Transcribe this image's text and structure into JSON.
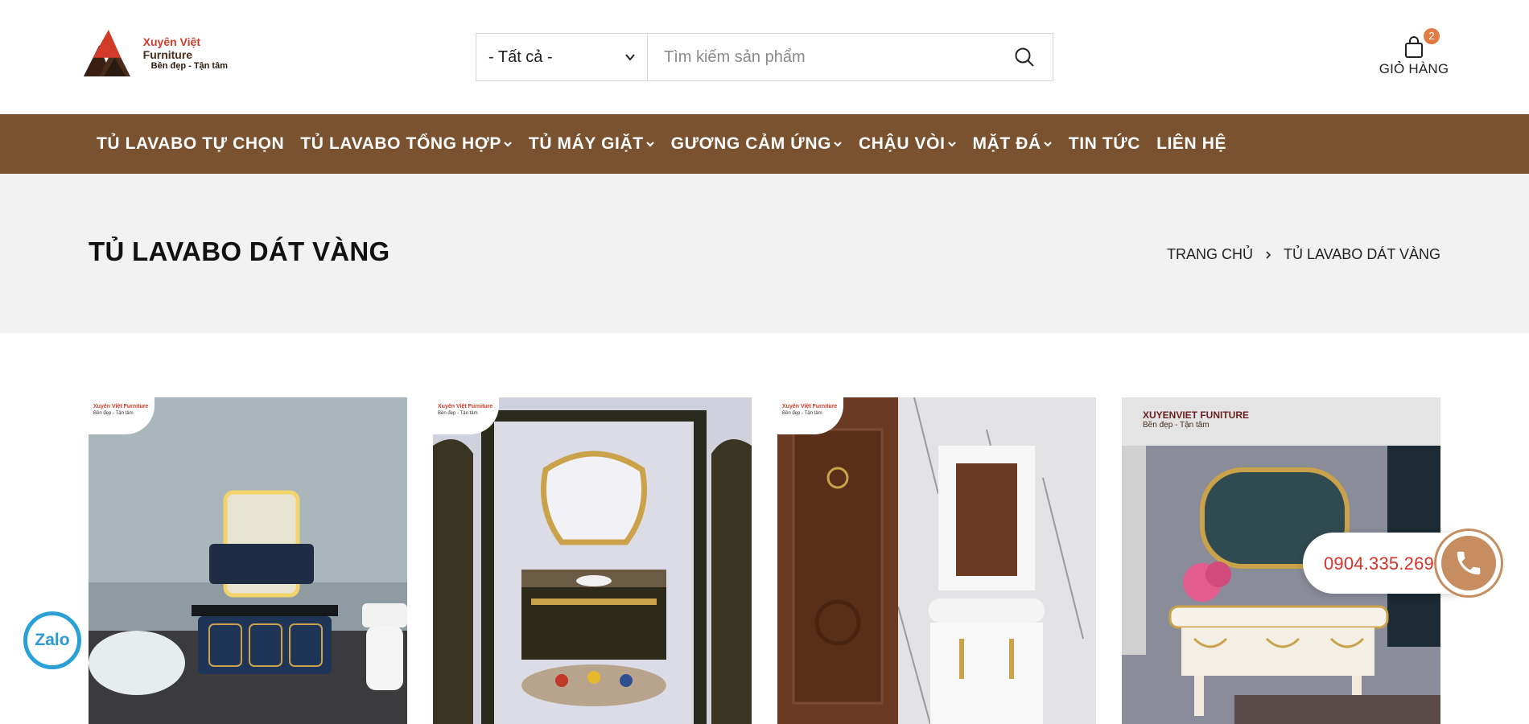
{
  "brand": {
    "name_part1": "Xuyên Việt",
    "name_part2": "Furniture",
    "tagline": "Bền đẹp - Tận tâm",
    "colors": {
      "brown": "#7a5230",
      "dark": "#4a2c1a",
      "red": "#d23b2a"
    }
  },
  "search": {
    "category_selected": "- Tất cả -",
    "placeholder": "Tìm kiếm sản phẩm",
    "value": ""
  },
  "cart": {
    "label": "GIỎ HÀNG",
    "count": "2"
  },
  "nav": {
    "items": [
      {
        "label": "TỦ LAVABO TỰ CHỌN",
        "has_dropdown": false
      },
      {
        "label": "TỦ LAVABO TỔNG HỢP",
        "has_dropdown": true
      },
      {
        "label": "TỦ MÁY GIẶT",
        "has_dropdown": true
      },
      {
        "label": "GƯƠNG CẢM ỨNG",
        "has_dropdown": true
      },
      {
        "label": "CHẬU VÒI",
        "has_dropdown": true
      },
      {
        "label": "MẶT ĐÁ",
        "has_dropdown": true
      },
      {
        "label": "TIN TỨC",
        "has_dropdown": false
      },
      {
        "label": "LIÊN HỆ",
        "has_dropdown": false
      }
    ]
  },
  "page": {
    "title": "TỦ LAVABO DÁT VÀNG",
    "breadcrumb": [
      "TRANG CHỦ",
      "TỦ LAVABO DÁT VÀNG"
    ]
  },
  "products": [
    {
      "image": "navy-vanity-with-led-mirror",
      "badge_line1": "Xuyên Việt Furniture",
      "badge_line2": "Bền đẹp - Tận tâm"
    },
    {
      "image": "gilded-black-vanity-ornate-mirror",
      "badge_line1": "Xuyên Việt Furniture",
      "badge_line2": "Bền đẹp - Tận tâm"
    },
    {
      "image": "white-vanity-wood-door-marble",
      "badge_line1": "Xuyên Việt Furniture",
      "badge_line2": "Bền đẹp - Tận tâm"
    },
    {
      "image": "white-gold-baroque-vanity",
      "badge_line1": "XUYENVIET FUNITURE",
      "badge_line2": "Bền đẹp - Tận tâm"
    }
  ],
  "widgets": {
    "zalo_label": "Zalo",
    "phone": "0904.335.269"
  }
}
